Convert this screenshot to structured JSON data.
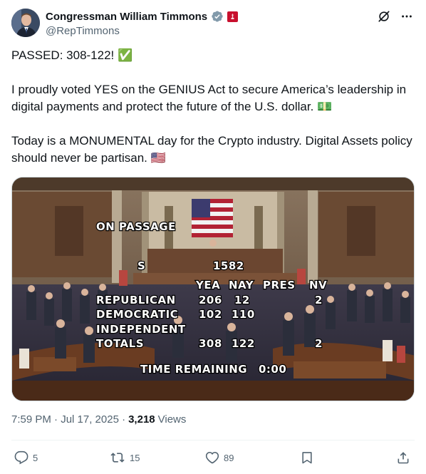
{
  "author": {
    "display_name": "Congressman William Timmons",
    "handle": "@RepTimmons"
  },
  "post": {
    "line1": "PASSED: 308-122! ✅",
    "line2": "I proudly voted YES on the GENIUS Act to secure America’s leadership in digital payments and protect the future of the U.S. dollar. 💵",
    "line3": "Today is a MONUMENTAL day for the Crypto industry. Digital Assets policy should never be partisan. 🇺🇸"
  },
  "vote_board": {
    "title": "ON PASSAGE",
    "bill_prefix": "S",
    "bill_number": "1582",
    "headers": [
      "YEA",
      "NAY",
      "PRES",
      "NV"
    ],
    "rows": [
      {
        "label": "REPUBLICAN",
        "yea": "206",
        "nay": "12",
        "pres": "",
        "nv": "2"
      },
      {
        "label": "DEMOCRATIC",
        "yea": "102",
        "nay": "110",
        "pres": "",
        "nv": ""
      },
      {
        "label": "INDEPENDENT",
        "yea": "",
        "nay": "",
        "pres": "",
        "nv": ""
      },
      {
        "label": "TOTALS",
        "yea": "308",
        "nay": "122",
        "pres": "",
        "nv": "2"
      }
    ],
    "time_label": "TIME REMAINING",
    "time_value": "0:00"
  },
  "meta": {
    "time": "7:59 PM · Jul 17, 2025 ·",
    "views_count": "3,218",
    "views_label": "Views"
  },
  "actions": {
    "replies": "5",
    "reposts": "15",
    "likes": "89"
  },
  "colors": {
    "verified": "#829aab",
    "gov_badge": "#c8102e",
    "text_secondary": "#536471"
  }
}
